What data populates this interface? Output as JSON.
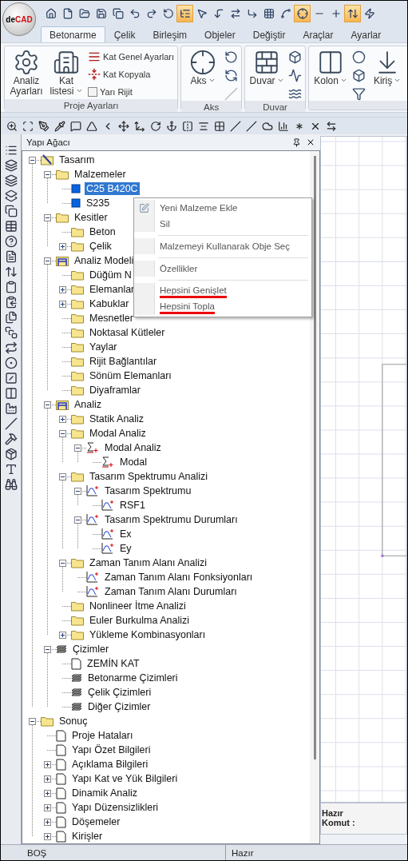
{
  "logo": {
    "prefix": "de",
    "name": "CAD"
  },
  "quick_access": [
    {
      "on": false
    },
    {
      "on": false
    },
    {
      "on": false
    },
    {
      "on": false
    },
    {
      "on": false
    },
    {
      "on": false
    },
    {
      "on": false
    },
    {
      "on": false
    },
    {
      "on": true
    },
    {
      "on": false
    },
    {
      "on": false
    },
    {
      "on": false
    },
    {
      "on": false
    },
    {
      "on": false
    },
    {
      "on": false
    },
    {
      "on": true
    },
    {
      "on": false
    },
    {
      "on": false
    },
    {
      "on": true
    },
    {
      "on": false
    }
  ],
  "tabs": [
    {
      "label": "Betonarme",
      "selected": true
    },
    {
      "label": "Çelik",
      "selected": false
    },
    {
      "label": "Birleşim",
      "selected": false
    },
    {
      "label": "Objeler",
      "selected": false
    },
    {
      "label": "Değiştir",
      "selected": false
    },
    {
      "label": "Araçlar",
      "selected": false
    },
    {
      "label": "Ayarlar",
      "selected": false
    }
  ],
  "ribbon": [
    {
      "label": "Proje Ayarları",
      "items": [
        {
          "kind": "large",
          "label": "Analiz Ayarları",
          "dropdown": false
        },
        {
          "kind": "large",
          "label": "Kat listesi",
          "dropdown": true
        },
        {
          "kind": "stack",
          "entries": [
            {
              "kind": "small",
              "label": "Kat Genel Ayarları"
            },
            {
              "kind": "small",
              "label": "Kat Kopyala"
            },
            {
              "kind": "check",
              "label": "Yarı Rijit",
              "checked": false
            }
          ]
        }
      ]
    },
    {
      "label": "Aks",
      "items": [
        {
          "kind": "large",
          "label": "Aks",
          "dropdown": true
        },
        {
          "kind": "tools",
          "tools": [
            {
              "disabled": false
            },
            {
              "disabled": false
            },
            {
              "disabled": true
            }
          ]
        }
      ]
    },
    {
      "label": "Duvar",
      "items": [
        {
          "kind": "large",
          "label": "Duvar",
          "dropdown": true
        },
        {
          "kind": "tools",
          "tools": [
            {
              "disabled": false
            },
            {
              "disabled": false
            },
            {
              "disabled": false
            }
          ]
        }
      ]
    },
    {
      "items": [
        {
          "kind": "large",
          "label": "Kolon",
          "dropdown": true
        },
        {
          "kind": "tools",
          "tools": [
            {
              "disabled": false
            },
            {
              "disabled": false
            },
            {
              "disabled": false
            }
          ]
        },
        {
          "kind": "large",
          "label": "Kiriş",
          "dropdown": true
        }
      ]
    }
  ],
  "panel": {
    "title": "Yapı Ağacı"
  },
  "tree": [
    {
      "label": "Tasarım",
      "kind": "root",
      "expanded": true,
      "selected": false,
      "children": [
        {
          "label": "Malzemeler",
          "kind": "folder",
          "expanded": true,
          "selected": false,
          "children": [
            {
              "label": "C25 B420C",
              "kind": "material",
              "selected": true
            },
            {
              "label": "S235",
              "kind": "material",
              "selected": false
            }
          ]
        },
        {
          "label": "Kesitler",
          "kind": "folder",
          "expanded": true,
          "selected": false,
          "children": [
            {
              "label": "Beton",
              "kind": "folder",
              "selected": false
            },
            {
              "label": "Çelik",
              "kind": "folder",
              "expanded": false,
              "selected": false
            }
          ]
        },
        {
          "label": "Analiz Modeli",
          "kind": "frame",
          "expanded": true,
          "selected": false,
          "children": [
            {
              "label": "Düğüm N",
              "kind": "folder",
              "selected": false
            },
            {
              "label": "Elemanlar",
              "kind": "folder",
              "expanded": false,
              "selected": false
            },
            {
              "label": "Kabuklar",
              "kind": "folder",
              "expanded": false,
              "selected": false
            },
            {
              "label": "Mesnetler",
              "kind": "folder",
              "selected": false
            },
            {
              "label": "Noktasal Kütleler",
              "kind": "folder",
              "selected": false
            },
            {
              "label": "Yaylar",
              "kind": "folder",
              "selected": false
            },
            {
              "label": "Rijit Bağlantılar",
              "kind": "folder",
              "selected": false
            },
            {
              "label": "Sönüm Elemanları",
              "kind": "folder",
              "selected": false
            },
            {
              "label": "Diyaframlar",
              "kind": "folder",
              "selected": false
            }
          ]
        },
        {
          "label": "Analiz",
          "kind": "frame",
          "expanded": true,
          "selected": false,
          "children": [
            {
              "label": "Statik Analiz",
              "kind": "folder",
              "expanded": false,
              "selected": false
            },
            {
              "label": "Modal Analiz",
              "kind": "folder",
              "expanded": true,
              "selected": false,
              "children": [
                {
                  "label": "Modal Analiz",
                  "kind": "sigma",
                  "expanded": true,
                  "selected": false,
                  "children": [
                    {
                      "label": "Modal",
                      "kind": "sigma",
                      "selected": false
                    }
                  ]
                }
              ]
            },
            {
              "label": "Tasarım Spektrumu Analizi",
              "kind": "folder",
              "expanded": true,
              "selected": false,
              "children": [
                {
                  "label": "Tasarım Spektrumu",
                  "kind": "spectrum",
                  "expanded": true,
                  "selected": false,
                  "children": [
                    {
                      "label": "RSF1",
                      "kind": "spectrum",
                      "selected": false
                    }
                  ]
                },
                {
                  "label": "Tasarım Spektrumu Durumları",
                  "kind": "spectrum",
                  "expanded": true,
                  "selected": false,
                  "children": [
                    {
                      "label": "Ex",
                      "kind": "spectrum",
                      "selected": false
                    },
                    {
                      "label": "Ey",
                      "kind": "spectrum",
                      "selected": false
                    }
                  ]
                }
              ]
            },
            {
              "label": "Zaman Tanım Alanı Analizi",
              "kind": "folder",
              "expanded": true,
              "selected": false,
              "children": [
                {
                  "label": "Zaman Tanım Alanı Fonksiyonları",
                  "kind": "spectrum",
                  "selected": false
                },
                {
                  "label": "Zaman Tanım Alanı Durumları",
                  "kind": "spectrum",
                  "selected": false
                }
              ]
            },
            {
              "label": "Nonlineer İtme Analizi",
              "kind": "folder",
              "selected": false
            },
            {
              "label": "Euler Burkulma Analizi",
              "kind": "folder",
              "selected": false
            },
            {
              "label": "Yükleme Kombinasyonları",
              "kind": "folder",
              "expanded": false,
              "selected": false
            }
          ]
        },
        {
          "label": "Çizimler",
          "kind": "drawings",
          "expanded": true,
          "selected": false,
          "children": [
            {
              "label": "ZEMİN KAT",
              "kind": "page",
              "selected": false
            },
            {
              "label": "Betonarme Çizimleri",
              "kind": "drawings",
              "selected": false
            },
            {
              "label": "Çelik Çizimleri",
              "kind": "drawings",
              "selected": false
            },
            {
              "label": "Diğer Çizimler",
              "kind": "drawings",
              "selected": false
            }
          ]
        }
      ]
    },
    {
      "label": "Sonuç",
      "kind": "folder",
      "expanded": true,
      "selected": false,
      "children": [
        {
          "label": "Proje Hataları",
          "kind": "page",
          "selected": false
        },
        {
          "label": "Yapı Özet Bilgileri",
          "kind": "page",
          "selected": false
        },
        {
          "label": "Açıklama Bilgileri",
          "kind": "page",
          "expanded": false,
          "selected": false
        },
        {
          "label": "Yapı Kat ve Yük Bilgileri",
          "kind": "page",
          "expanded": false,
          "selected": false
        },
        {
          "label": "Dinamik Analiz",
          "kind": "page",
          "expanded": false,
          "selected": false
        },
        {
          "label": "Yapı Düzensizlikleri",
          "kind": "page",
          "expanded": false,
          "selected": false
        },
        {
          "label": "Döşemeler",
          "kind": "page",
          "expanded": false,
          "selected": false
        },
        {
          "label": "Kirişler",
          "kind": "page",
          "expanded": false,
          "selected": false
        }
      ]
    }
  ],
  "context_menu": [
    {
      "kind": "item",
      "label": "Yeni Malzeme Ekle",
      "icon": true,
      "highlighted": false
    },
    {
      "kind": "item",
      "label": "Sil",
      "icon": false,
      "highlighted": false
    },
    {
      "kind": "separator"
    },
    {
      "kind": "item",
      "label": "Malzemeyi Kullanarak Obje Seç",
      "icon": false,
      "highlighted": false
    },
    {
      "kind": "separator"
    },
    {
      "kind": "item",
      "label": "Özellikler",
      "icon": false,
      "highlighted": false
    },
    {
      "kind": "separator"
    },
    {
      "kind": "item",
      "label": "Hepsini Genişlet",
      "icon": false,
      "highlighted": true
    },
    {
      "kind": "item",
      "label": "Hepsini Topla",
      "icon": false,
      "highlighted": true
    }
  ],
  "command_area": {
    "status": "Hazır",
    "prompt": "Komut :"
  },
  "status_bar": [
    "BOŞ",
    "Hazır"
  ]
}
